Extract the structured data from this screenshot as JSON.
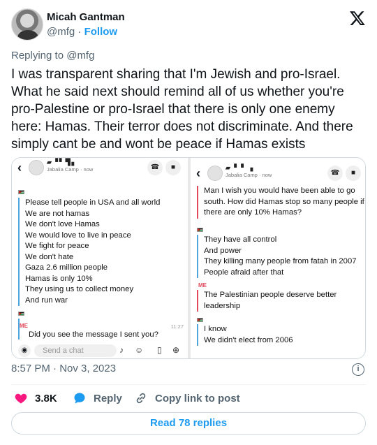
{
  "author": {
    "name": "Micah Gantman",
    "handle": "@mfg",
    "dot": "·",
    "follow_label": "Follow"
  },
  "replying_to": "Replying to @mfg",
  "tweet_text": "I was transparent sharing that I'm Jewish and pro-Israel. What he said next should remind all of us whether you're pro-Palestine or pro-Israel that there is only one enemy here: Hamas. Their terror does not discriminate. And there simply cant be and wont be peace if Hamas exists",
  "screenshot_left": {
    "contact_location": "Jabalia Camp · now",
    "messages": [
      "Please tell people in USA and all world",
      "We are not hamas",
      "We don't love Hamas",
      "We would love to live in peace",
      "We fight for peace",
      "We don't hate",
      "Gaza 2.6 million people",
      "Hamas is only 10%",
      "They using us to collect money",
      "And run war"
    ],
    "me_label": "ME",
    "me_time": "11:27",
    "me_message": "Did you see the message I sent you?",
    "compose_placeholder": "Send a chat"
  },
  "screenshot_right": {
    "contact_location": "Jabalia Camp · now",
    "me_messages_top": [
      "Man I wish you would have been able to go",
      "south. How did Hamas stop so many people if",
      "there are only 10% Hamas?"
    ],
    "them_messages": [
      "They have all control",
      "And power",
      "They killing many people from fatah in 2007",
      "People afraid after that"
    ],
    "me_label": "ME",
    "me_messages": [
      "The Palestinian people deserve better",
      "leadership"
    ],
    "them_messages_2": [
      "I know",
      "We didn't elect from 2006"
    ]
  },
  "timestamp": "8:57 PM · Nov 3, 2023",
  "actions": {
    "likes": "3.8K",
    "reply_label": "Reply",
    "copy_label": "Copy link to post"
  },
  "read_replies_label": "Read 78 replies",
  "colors": {
    "accent": "#1d9bf0",
    "like": "#f91880",
    "muted": "#536471"
  }
}
